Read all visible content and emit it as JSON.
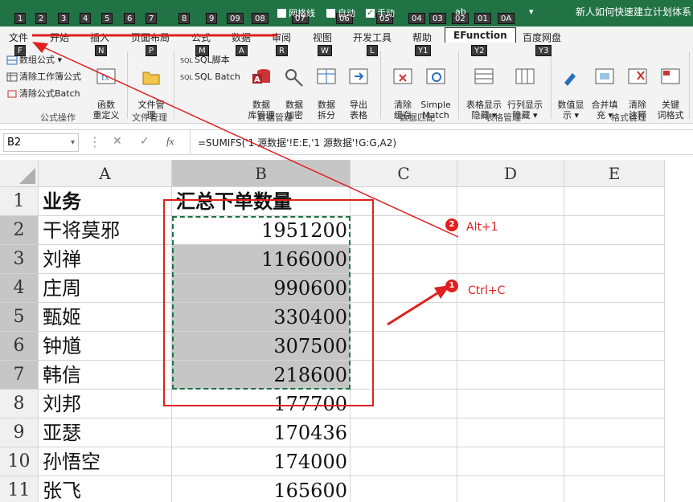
{
  "window_title": "新人如何快速建立计划体系",
  "quick_access": {
    "keytips": [
      "1",
      "2",
      "3",
      "4",
      "5",
      "6",
      "7",
      "8",
      "9",
      "09",
      "08",
      "07",
      "06",
      "05",
      "04",
      "03",
      "02",
      "01",
      "0A"
    ],
    "checkbox_gridlines": "网格线",
    "checkbox_auto": "自动",
    "checkbox_manual": "手动",
    "icon_ab": "ab"
  },
  "tabs": [
    "文件",
    "开始",
    "插入",
    "页面布局",
    "公式",
    "数据",
    "审阅",
    "视图",
    "开发工具",
    "帮助",
    "EFunction",
    "百度网盘"
  ],
  "ribbon_keytips": [
    "F",
    "N",
    "P",
    "M",
    "A",
    "R",
    "W",
    "L",
    "Y1",
    "Y2",
    "Y3"
  ],
  "ribbon": {
    "g1": {
      "item1": "数组公式",
      "item2": "清除工作簿公式",
      "item3": "清除公式Batch",
      "label": "公式操作"
    },
    "func_redef": "函数\n重定义",
    "g2": {
      "file_mgmt": "文件管\n理",
      "label": "文件管理"
    },
    "g3": {
      "sql_script": "SQL脚本",
      "sql_batch": "SQL Batch",
      "db_mgmt": "数据\n库管理",
      "data_encrypt": "数据\n加密",
      "data_split": "数据\n拆分",
      "export_table": "导出\n表格",
      "label": "数据管理"
    },
    "g4": {
      "clear_cache": "清除\n缓存",
      "simple_match": "Simple\nMatch",
      "label": "数据匹配"
    },
    "g5": {
      "table_hide_show": "表格显示\n隐藏",
      "row_hide_show": "行列显示\n隐藏",
      "label": "表格管理"
    },
    "g6": {
      "value_show": "数值显\n示",
      "merge_fill": "合并填\n充",
      "clear_comment": "清除\n注释",
      "key_cell": "关键\n词格式",
      "label": "格式管理"
    }
  },
  "formula_bar": {
    "name_box": "B2",
    "cancel": "✕",
    "enter": "✓",
    "fx": "fx",
    "formula": "=SUMIFS('1 源数据'!E:E,'1 源数据'!G:G,A2)"
  },
  "columns": [
    "A",
    "B",
    "C",
    "D",
    "E"
  ],
  "rows": [
    {
      "num": "1",
      "a": "业务",
      "b": "汇总下单数量"
    },
    {
      "num": "2",
      "a": "干将莫邪",
      "b": "1951200"
    },
    {
      "num": "3",
      "a": "刘禅",
      "b": "1166000"
    },
    {
      "num": "4",
      "a": "庄周",
      "b": "990600"
    },
    {
      "num": "5",
      "a": "甄姬",
      "b": "330400"
    },
    {
      "num": "6",
      "a": "钟馗",
      "b": "307500"
    },
    {
      "num": "7",
      "a": "韩信",
      "b": "218600"
    },
    {
      "num": "8",
      "a": "刘邦",
      "b": "177700"
    },
    {
      "num": "9",
      "a": "亚瑟",
      "b": "170436"
    },
    {
      "num": "10",
      "a": "孙悟空",
      "b": "174000"
    },
    {
      "num": "11",
      "a": "张飞",
      "b": "165600"
    }
  ],
  "annotations": {
    "step1": {
      "num": "1",
      "text": "Ctrl+C"
    },
    "step2": {
      "num": "2",
      "text": "Alt+1"
    }
  },
  "colors": {
    "excel_green": "#217346",
    "annotation_red": "#e02020",
    "selection_gray": "#c6c6c6",
    "marquee_green": "#1e7145"
  }
}
